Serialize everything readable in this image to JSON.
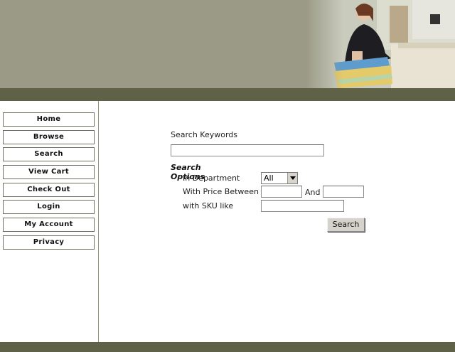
{
  "colors": {
    "banner": "#9a9a86",
    "bar": "#5f6246",
    "divider": "#8f9477"
  },
  "banner": {
    "image": "teacher-with-books-photo"
  },
  "nav": {
    "items": [
      {
        "label": "Home"
      },
      {
        "label": "Browse"
      },
      {
        "label": "Search"
      },
      {
        "label": "View Cart"
      },
      {
        "label": "Check Out"
      },
      {
        "label": "Login"
      },
      {
        "label": "My Account"
      },
      {
        "label": "Privacy"
      }
    ]
  },
  "search": {
    "keywords_label": "Search Keywords",
    "keywords_value": "",
    "options_title": "Search Options",
    "department_label": "In Department",
    "department_value": "All",
    "price_label": "With Price Between",
    "price_and_label": "And",
    "price_min_value": "",
    "price_max_value": "",
    "sku_label": "with SKU like",
    "sku_value": "",
    "button_label": "Search"
  }
}
